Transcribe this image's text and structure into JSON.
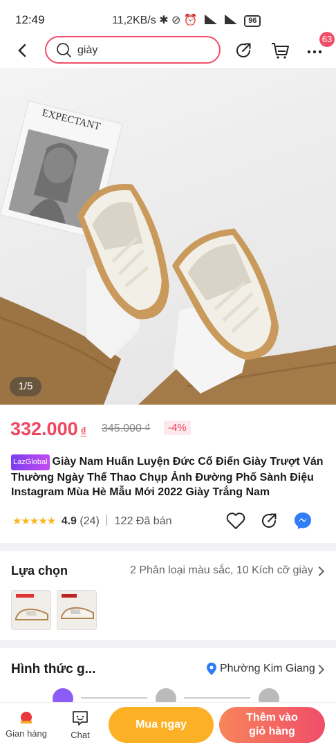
{
  "status_bar": {
    "time": "12:49",
    "net_speed": "11,2KB/s",
    "battery": "96"
  },
  "header": {
    "search_text": "giày",
    "cart_badge": "63"
  },
  "gallery": {
    "counter": "1/5",
    "magazine_title": "EXPECTANT"
  },
  "product": {
    "price": "332.000",
    "price_currency": "₫",
    "old_price": "345.000 ₫",
    "discount": "-4%",
    "brand_tag": "LazGlobal",
    "title": "Giày Nam Huấn Luyện Đức Cổ Điển Giày Trượt Ván Thường Ngày Thể Thao Chụp Ảnh Đường Phố Sành Điệu Instagram Mùa Hè Mẫu Mới 2022 Giày Trắng Nam",
    "stars": "★★★★★",
    "rating": "4.9",
    "rating_count": "(24)",
    "sold": "122 Đã bán"
  },
  "options": {
    "label": "Lựa chọn",
    "summary": "2 Phân loại màu sắc, 10 Kích cỡ giày"
  },
  "delivery": {
    "label": "Hình thức g...",
    "location": "Phường Kim Giang"
  },
  "bottom_bar": {
    "store_label": "Gian hàng",
    "chat_label": "Chat",
    "buy_now": "Mua ngay",
    "add_to_cart_line1": "Thêm vào",
    "add_to_cart_line2": "giỏ hàng"
  },
  "colors": {
    "accent": "#f0445f",
    "buy_now": "#fcb026",
    "add_to_cart": "#f04d69"
  }
}
